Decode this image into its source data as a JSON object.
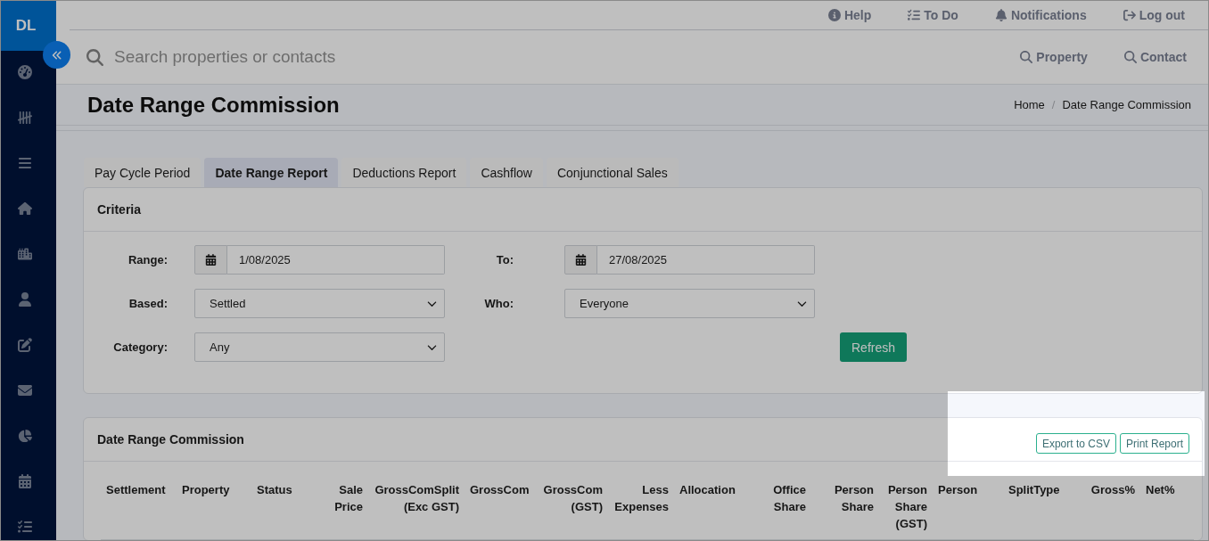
{
  "sidebar": {
    "initials": "DL"
  },
  "top_links": [
    {
      "label": "Help"
    },
    {
      "label": "To Do"
    },
    {
      "label": "Notifications"
    },
    {
      "label": "Log out"
    }
  ],
  "search": {
    "placeholder": "Search properties or contacts",
    "scopes": [
      "Property",
      "Contact"
    ]
  },
  "page": {
    "title": "Date Range Commission",
    "breadcrumb": [
      "Home",
      "Date Range Commission"
    ],
    "breadcrumb_separator": "/"
  },
  "tabs": [
    {
      "label": "Pay Cycle Period",
      "selected": false
    },
    {
      "label": "Date Range Report",
      "selected": true
    },
    {
      "label": "Deductions Report",
      "selected": false
    },
    {
      "label": "Cashflow",
      "selected": false
    },
    {
      "label": "Conjunctional Sales",
      "selected": false
    }
  ],
  "criteria": {
    "title": "Criteria",
    "fields": [
      {
        "kind": "date",
        "label": "Range:",
        "value": "1/08/2025"
      },
      {
        "kind": "date",
        "label": "To:",
        "value": "27/08/2025"
      },
      {
        "kind": "select",
        "label": "Based:",
        "value": "Settled"
      },
      {
        "kind": "select",
        "label": "Who:",
        "value": "Everyone"
      },
      {
        "kind": "select",
        "label": "Category:",
        "value": "Any"
      }
    ],
    "refresh_button": "Refresh"
  },
  "report": {
    "title": "Date Range Commission",
    "actions": [
      "Export to CSV",
      "Print Report"
    ],
    "actions_highlighted": true,
    "columns": [
      "Settlement",
      "Property",
      "Status",
      "Sale Price",
      "GrossComSplit (Exc GST)",
      "GrossCom",
      "GrossCom (GST)",
      "Less Expenses",
      "Allocation",
      "Office Share",
      "Person Share",
      "Person Share (GST)",
      "Person",
      "SplitType",
      "Gross%",
      "Net%"
    ]
  }
}
